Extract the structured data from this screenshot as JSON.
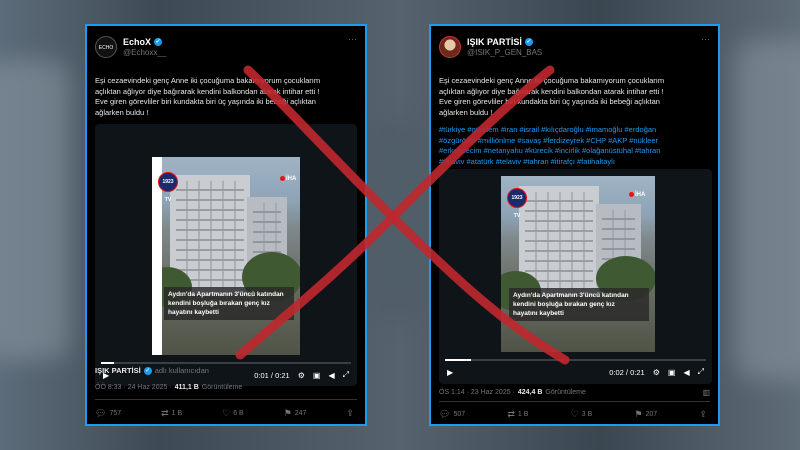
{
  "colors": {
    "accent": "#1d9bf0",
    "cross": "#c0272d",
    "panel_bg": "#000000"
  },
  "left_tweet": {
    "author_name": "EchoX",
    "author_handle": "@Echoxx__",
    "avatar_text": "ECHO",
    "text_lines": [
      "Eşi cezaevindeki genç Anne iki çocuğuma bakamıyorum  çocuklarım",
      "açlıktan ağlıyor diye bağırarak kendini balkondan atarak intihar etti !",
      "Eve giren görevliler biri kundakta biri üç yaşında iki bebeği açlıktan",
      "ağlarken buldu !"
    ],
    "video": {
      "logo": "1923 TV",
      "iha": "İHA",
      "caption_lines": [
        "Aydın'da Apartmanın 3'üncü katından",
        "kendini boşluğa bırakan genç kız",
        "hayatını kaybetti"
      ],
      "time": "0:01 / 0:21",
      "progress": 0.05
    },
    "source_name": "IŞIK PARTİSİ",
    "source_suffix": "adlı kullanıcıdan",
    "meta_time": "ÖÖ 8:33 · 24 Haz 2025 ·",
    "views": "411,1 B",
    "views_label": "Görüntüleme",
    "replies": "757",
    "retweets": "1 B",
    "likes": "6 B",
    "bookmarks": "247"
  },
  "right_tweet": {
    "author_name": "IŞIK PARTİSİ",
    "author_handle": "@ISIK_P_GEN_BAS",
    "text_lines": [
      "Eşi cezaevindeki genç Anne iki çocuğuma bakamıyorum  çocuklarım",
      "açlıktan ağlıyor diye bağırarak kendini balkondan atarak intihar etti !",
      "Eve giren görevliler biri kundakta biri üç yaşında iki bebeği açlıktan",
      "ağlarken buldu !"
    ],
    "hashtag_lines": [
      "#türkiye #gündem #iran #israil #kılıçdaroğlu #imamoğlu #erdoğan",
      "#özgürözel #milliönlme #savaş #ferdizeyrek #CHP #AKP #nükleer",
      "#erkensecim #netanyahu #kürecik #incirlik #olağanüstühal #tahran",
      "#telaviv #atatürk #telaviv #tahran #itirafçı #fatihaltaylı"
    ],
    "video": {
      "logo": "1923 TV",
      "iha": "İHA",
      "caption_lines": [
        "Aydın'da Apartmanın 3'üncü katından",
        "kendini boşluğa bırakan genç kız",
        "hayatını kaybetti"
      ],
      "time": "0:02 / 0:21",
      "progress": 0.1
    },
    "meta_time": "ÖS 1:14 · 23 Haz 2025 ·",
    "views": "424,4 B",
    "views_label": "Görüntüleme",
    "replies": "507",
    "retweets": "1 B",
    "likes": "3 B",
    "bookmarks": "207"
  }
}
